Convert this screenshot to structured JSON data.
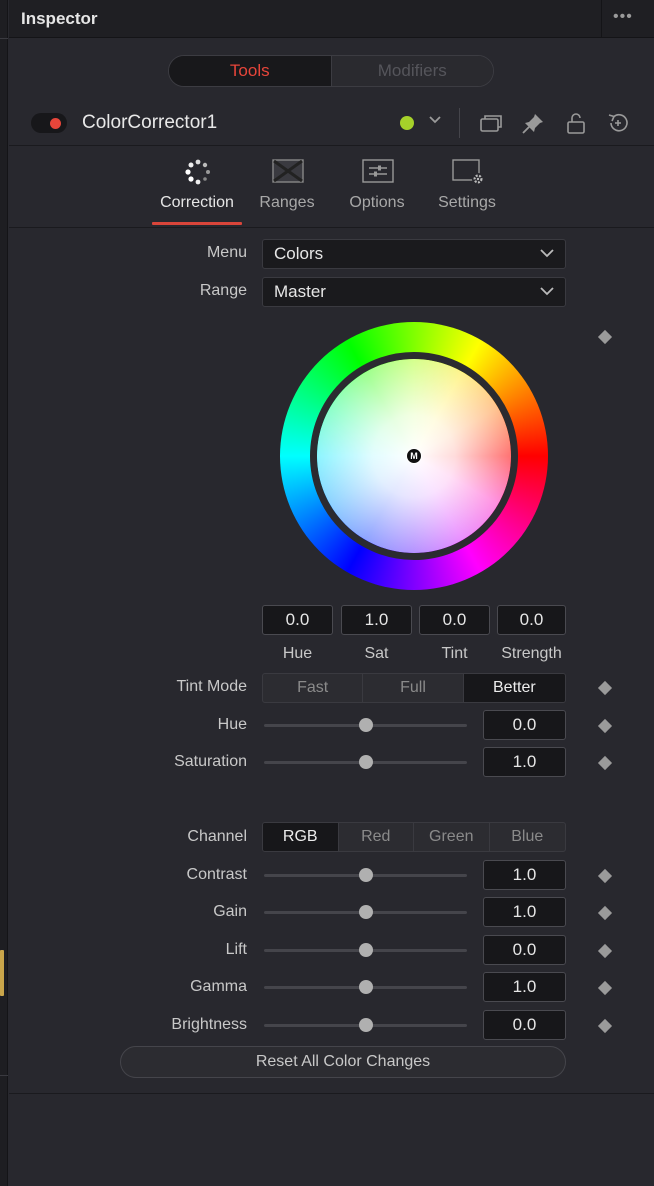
{
  "header": {
    "title": "Inspector",
    "menu_glyph": "•••"
  },
  "top_tabs": {
    "tools": "Tools",
    "modifiers": "Modifiers"
  },
  "tool": {
    "name": "ColorCorrector1",
    "chevron": "⌄"
  },
  "tabs": [
    {
      "label": "Correction",
      "icon": "correction-icon"
    },
    {
      "label": "Ranges",
      "icon": "ranges-icon"
    },
    {
      "label": "Options",
      "icon": "options-icon"
    },
    {
      "label": "Settings",
      "icon": "settings-icon"
    }
  ],
  "menu": {
    "label": "Menu",
    "value": "Colors"
  },
  "range": {
    "label": "Range",
    "value": "Master"
  },
  "wheel": {
    "center_label": "M"
  },
  "wheel_values": [
    {
      "value": "0.0",
      "label": "Hue"
    },
    {
      "value": "1.0",
      "label": "Sat"
    },
    {
      "value": "0.0",
      "label": "Tint"
    },
    {
      "value": "0.0",
      "label": "Strength"
    }
  ],
  "tint_mode": {
    "label": "Tint Mode",
    "options": [
      "Fast",
      "Full",
      "Better"
    ],
    "selected": "Better"
  },
  "hue": {
    "label": "Hue",
    "value": "0.0",
    "slider_fraction": 0.5
  },
  "saturation": {
    "label": "Saturation",
    "value": "1.0",
    "slider_fraction": 0.5
  },
  "channel": {
    "label": "Channel",
    "options": [
      "RGB",
      "Red",
      "Green",
      "Blue"
    ],
    "selected": "RGB"
  },
  "controls": [
    {
      "label": "Contrast",
      "value": "1.0",
      "slider_fraction": 0.5
    },
    {
      "label": "Gain",
      "value": "1.0",
      "slider_fraction": 0.5
    },
    {
      "label": "Lift",
      "value": "0.0",
      "slider_fraction": 0.5
    },
    {
      "label": "Gamma",
      "value": "1.0",
      "slider_fraction": 0.5
    },
    {
      "label": "Brightness",
      "value": "0.0",
      "slider_fraction": 0.5
    }
  ],
  "reset_button": "Reset All Color Changes",
  "colors": {
    "accent_red": "#e6453a",
    "node_green": "#a6d12a",
    "panel_bg": "#28282e"
  }
}
